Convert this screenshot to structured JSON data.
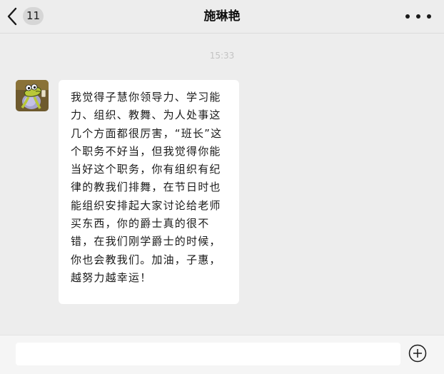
{
  "header": {
    "back_icon": "chevron-left-icon",
    "unread_count": "11",
    "title": "施琳艳",
    "more_icon": "more-dots-icon"
  },
  "chat": {
    "timestamp": "15:33",
    "messages": [
      {
        "avatar_icon": "cartoon-avatar",
        "text": "我觉得子慧你领导力、学习能力、组织、教舞、为人处事这几个方面都很厉害，“班长”这个职务不好当，但我觉得你能当好这个职务，你有组织有纪律的教我们排舞，在节日时也能组织安排起大家讨论给老师买东西，你的爵士真的很不错，在我们刚学爵士的时候，你也会教我们。加油，子惠，越努力越幸运！"
      }
    ]
  },
  "input_bar": {
    "value": "",
    "placeholder": "",
    "add_icon": "plus-circle-icon"
  },
  "colors": {
    "background": "#ededed",
    "bubble": "#ffffff",
    "text": "#1a1a1a",
    "timestamp": "#c3c3c3"
  }
}
